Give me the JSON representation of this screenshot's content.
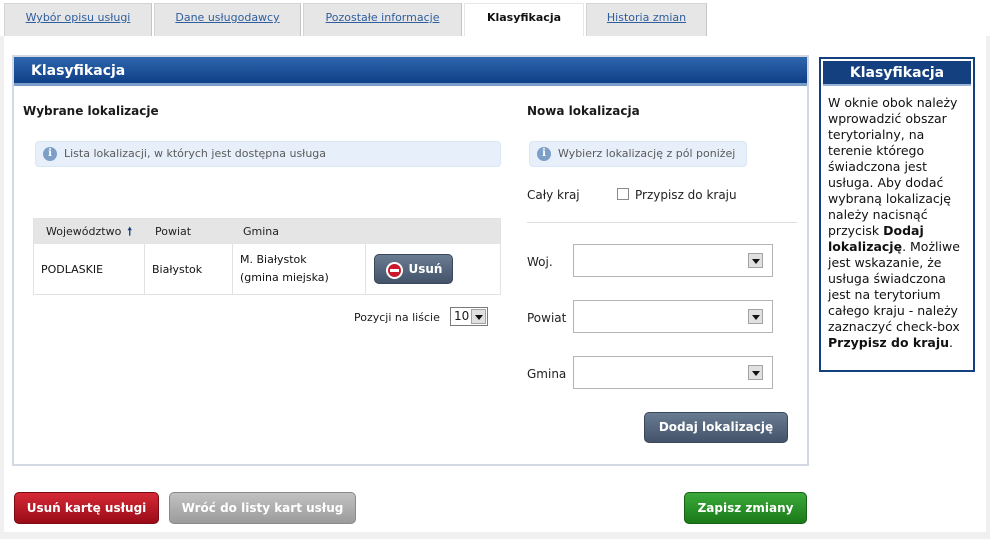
{
  "tabs": [
    {
      "label": "Wybór opisu usługi",
      "active": false
    },
    {
      "label": "Dane usługodawcy",
      "active": false
    },
    {
      "label": "Pozostałe informacje",
      "active": false
    },
    {
      "label": "Klasyfikacja",
      "active": true
    },
    {
      "label": "Historia zmian",
      "active": false
    }
  ],
  "panel": {
    "title": "Klasyfikacja"
  },
  "selected": {
    "title": "Wybrane lokalizacje",
    "info": "Lista lokalizacji, w których jest dostępna usługa",
    "table": {
      "headers": [
        "Województwo",
        "Powiat",
        "Gmina"
      ],
      "sort_icon": "sort-up-arrow-icon",
      "rows": [
        {
          "wojewodztwo": "PODLASKIE",
          "powiat": "Białystok",
          "gmina_line1": "M. Białystok",
          "gmina_line2": "(gmina miejska)",
          "action": "Usuń"
        }
      ]
    },
    "per_page_label": "Pozycji na liście",
    "per_page_value": "10"
  },
  "new_location": {
    "title": "Nowa lokalizacja",
    "info": "Wybierz lokalizację z pól poniżej",
    "whole_country_label": "Cały kraj",
    "assign_country_label": "Przypisz do kraju",
    "woj_label": "Woj.",
    "powiat_label": "Powiat",
    "gmina_label": "Gmina",
    "woj_value": "",
    "powiat_value": "",
    "gmina_value": "",
    "add_button": "Dodaj lokalizację"
  },
  "help": {
    "title": "Klasyfikacja",
    "text_1": "W oknie obok należy wprowadzić obszar terytorialny, na terenie którego świadczona jest usługa. Aby dodać wybraną lokalizację należy nacisnąć przycisk ",
    "bold_1": "Dodaj lokalizację",
    "text_2": ". Możliwe jest wskazanie, że usługa świadczona jest na terytorium całego kraju - należy zaznaczyć check-box ",
    "bold_2": "Przypisz do kraju",
    "text_3": "."
  },
  "footer": {
    "delete_card": "Usuń kartę usługi",
    "back_to_list": "Wróć do listy kart usług",
    "save": "Zapisz zmiany"
  },
  "colors": {
    "header_blue": "#15407f",
    "danger_red": "#c9192a",
    "save_green": "#2a9a28"
  }
}
